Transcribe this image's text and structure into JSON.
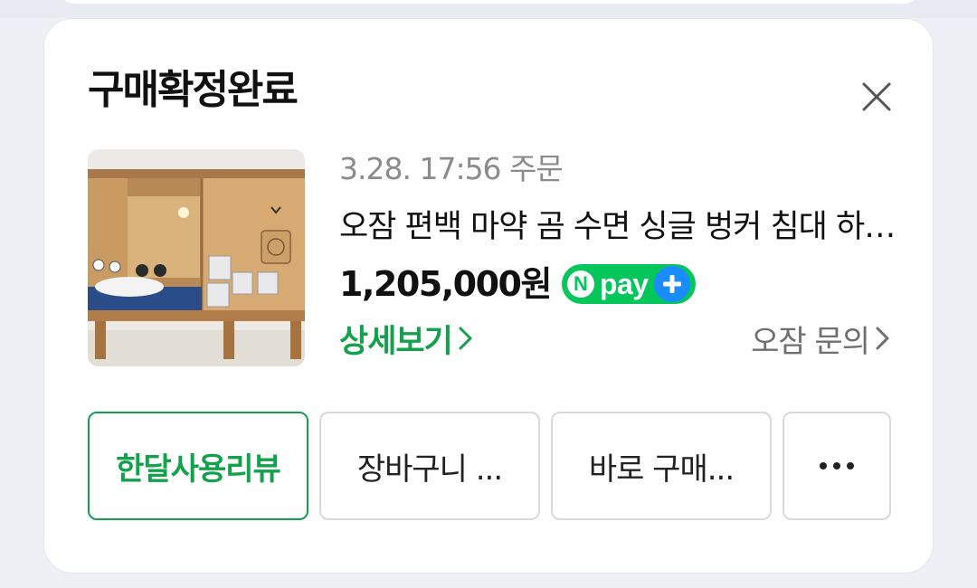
{
  "card": {
    "title": "구매확정완료"
  },
  "order": {
    "date_text": "3.28. 17:56 주문",
    "product_name": "오잠 편백 마약 곰 수면 싱글 벙커 침대 하우스",
    "price": "1,205,000원",
    "npay_badge": {
      "n_letter": "N",
      "word": "pay",
      "icon": "plus-icon"
    },
    "detail_link": "상세보기",
    "inquiry_link": "오잠 문의"
  },
  "actions": {
    "review": "한달사용리뷰",
    "cart": "장바구니 ...",
    "buy": "바로 구매...",
    "more_icon": "more-dots-icon"
  },
  "colors": {
    "accent_green": "#13a14b",
    "npay_green": "#03c75a",
    "npay_blue": "#1a8cff",
    "muted_text": "#8b8b8b"
  }
}
